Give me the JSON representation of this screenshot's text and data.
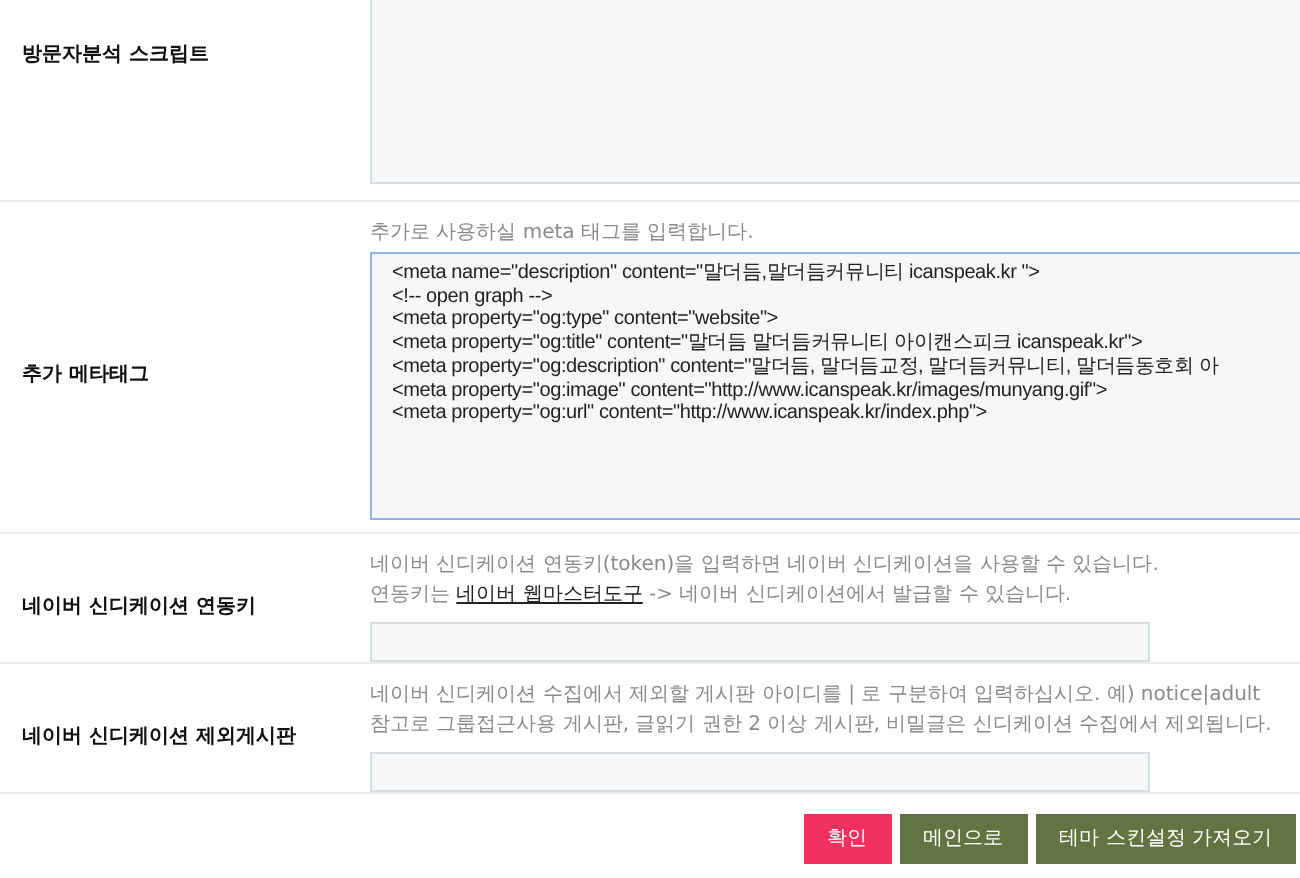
{
  "rows": [
    {
      "kind": "textarea",
      "label": "방문자분석 스크립트",
      "lines": []
    },
    {
      "kind": "textarea",
      "label": "추가 메타태그",
      "hint": "추가로 사용하실 meta 태그를 입력합니다.",
      "lines": [
        "<meta name=\"description\" content=\"말더듬,말더듬커뮤니티 icanspeak.kr \">",
        "<!-- open graph -->",
        "<meta property=\"og:type\" content=\"website\">",
        "<meta property=\"og:title\" content=\"말더듬 말더듬커뮤니티 아이캔스피크 icanspeak.kr\">",
        "<meta property=\"og:description\" content=\"말더듬, 말더듬교정, 말더듬커뮤니티, 말더듬동호회 아",
        "<meta property=\"og:image\" content=\"http://www.icanspeak.kr/images/munyang.gif\">",
        "<meta property=\"og:url\" content=\"http://www.icanspeak.kr/index.php\">"
      ]
    },
    {
      "kind": "input",
      "label": "네이버 신디케이션 연동키",
      "hints": [
        {
          "text": "네이버 신디케이션 연동키(token)을 입력하면 네이버 신디케이션을 사용할 수 있습니다."
        },
        {
          "before": "연동키는 ",
          "link": "네이버 웹마스터도구",
          "after": " -> 네이버 신디케이션에서 발급할 수 있습니다."
        }
      ]
    },
    {
      "kind": "input",
      "label": "네이버 신디케이션 제외게시판",
      "hints": [
        {
          "text": "네이버 신디케이션 수집에서 제외할 게시판 아이디를 | 로 구분하여 입력하십시오. 예) notice|adult"
        },
        {
          "text": "참고로 그룹접근사용 게시판, 글읽기 권한 2 이상 게시판, 비밀글은 신디케이션 수집에서 제외됩니다."
        }
      ]
    }
  ],
  "buttons": [
    {
      "label": "확인",
      "kind": "primary"
    },
    {
      "label": "메인으로",
      "kind": "secondary"
    },
    {
      "label": "테마 스킨설정 가져오기",
      "kind": "secondary"
    }
  ]
}
